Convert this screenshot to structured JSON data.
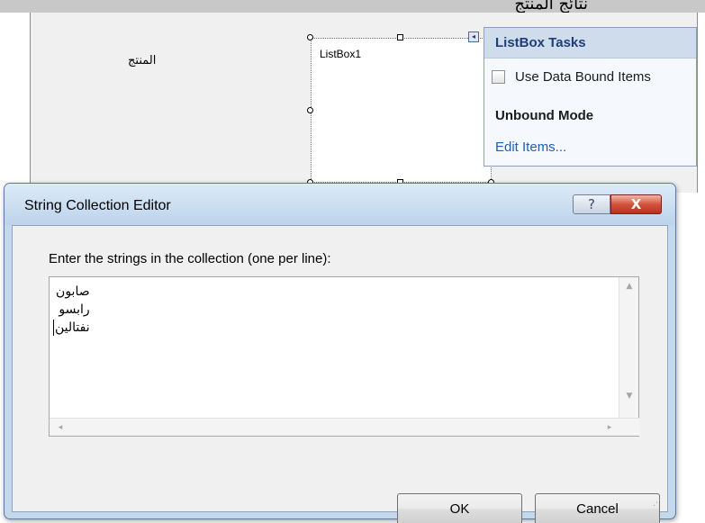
{
  "designer": {
    "top_clipped_text": "ﻧﺘﺎﺋﺞ اﻟﻤﻨﺘﺞ",
    "form_label": "المنتج",
    "listbox_name": "ListBox1",
    "smart_tag_glyph": "◂"
  },
  "tasks_panel": {
    "title": "ListBox Tasks",
    "checkbox_label": "Use Data Bound Items",
    "checkbox_checked": false,
    "mode_heading": "Unbound Mode",
    "edit_link": "Edit Items..."
  },
  "dialog": {
    "title": "String Collection Editor",
    "help_glyph": "?",
    "close_glyph": "X",
    "prompt": "Enter the strings in the collection (one per line):",
    "lines": [
      "صابون",
      "رابسو",
      "نفتالين"
    ],
    "ok_label": "OK",
    "cancel_label": "Cancel",
    "scroll_up": "▲",
    "scroll_down": "▼",
    "scroll_left": "◂",
    "scroll_right": "▸",
    "grip_glyph": "⋰"
  },
  "colors": {
    "dialog_frame": "#c4d8ec",
    "close_button": "#c8452c",
    "link": "#1f5fb5",
    "panel_header": "#cfdcec"
  }
}
